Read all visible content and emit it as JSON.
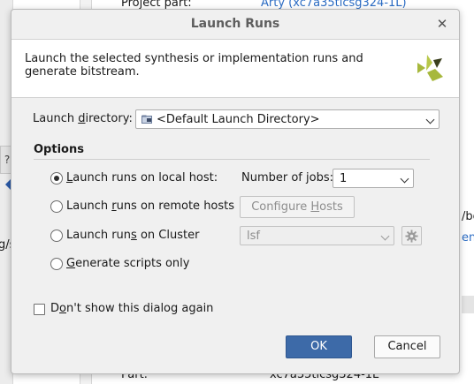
{
  "background": {
    "project_part_label": "Project part:",
    "project_part_value": "Arty (xc7a35ticsg324-1L)",
    "side_button": "?",
    "frag_left": "g/s",
    "frag_right_1": "/bo",
    "frag_right_2": "end",
    "bottom_label": "Part:",
    "bottom_value": "xc7a35ticsg324-1L"
  },
  "dialog": {
    "title": "Launch Runs",
    "description": "Launch the selected synthesis or implementation runs and generate bitstream.",
    "launch_directory": {
      "label_pre": "Launch ",
      "label_mn": "d",
      "label_post": "irectory:",
      "value": "<Default Launch Directory>"
    },
    "options_title": "Options",
    "local_host": {
      "pre": "",
      "mn": "L",
      "post": "aunch runs on local host:",
      "checked": true
    },
    "jobs": {
      "label": "Number of jobs:",
      "value": "1"
    },
    "remote_hosts": {
      "pre": "Launch ",
      "mn": "r",
      "post": "uns on remote hosts",
      "checked": false
    },
    "configure_hosts": {
      "pre": "Configure ",
      "mn": "H",
      "post": "osts"
    },
    "cluster": {
      "pre": "Launch run",
      "mn": "s",
      "post": " on Cluster",
      "checked": false,
      "value": "lsf"
    },
    "scripts_only": {
      "pre": "",
      "mn": "G",
      "post": "enerate scripts only",
      "checked": false
    },
    "dont_show": {
      "pre": "D",
      "mn": "o",
      "post": "n't show this dialog again",
      "checked": false
    },
    "ok_label": "OK",
    "cancel_label": "Cancel"
  },
  "colors": {
    "primary_button": "#3d6aa8",
    "logo_green": "#a7b83c",
    "logo_dark": "#3a3f1e"
  }
}
